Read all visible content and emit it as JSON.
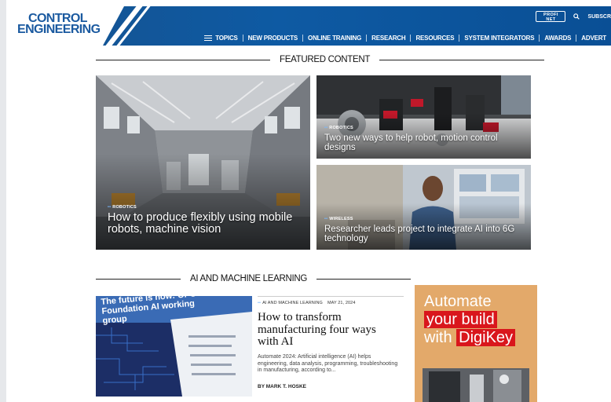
{
  "brand": {
    "logo_line1": "CONTROL",
    "logo_line2": "ENGINEERING",
    "profinet_line1": "PROFI",
    "profinet_line2": "NET"
  },
  "header": {
    "subscribe_label": "SUBSCR",
    "nav": [
      "TOPICS",
      "NEW PRODUCTS",
      "ONLINE TRAINING",
      "RESEARCH",
      "RESOURCES",
      "SYSTEM INTEGRATORS",
      "AWARDS",
      "ADVERT"
    ]
  },
  "featured": {
    "heading": "FEATURED CONTENT",
    "main": {
      "category": "ROBOTICS",
      "title": "How to produce flexibly using mobile robots, machine vision"
    },
    "side1": {
      "category": "ROBOTICS",
      "title": "Two new ways to help robot, motion control designs"
    },
    "side2": {
      "category": "WIRELESS",
      "title": "Researcher leads project to integrate AI into 6G technology"
    }
  },
  "ai_section": {
    "heading": "AI AND MACHINE LEARNING",
    "article": {
      "category": "AI AND MACHINE LEARNING",
      "date": "MAY 21, 2024",
      "title": "How to transform manufacturing four ways with AI",
      "excerpt": "Automate 2024: Artificial intelligence (AI) helps engineering, data analysis, programming, troubleshooting in manufacturing, according to...",
      "author": "BY MARK T. HOSKE",
      "image_heading": "The future is now: OPC Foundation AI working group"
    }
  },
  "ad": {
    "line1": "Automate",
    "line2": "your build",
    "line3_prefix": "with",
    "line3_brand": "DigiKey"
  },
  "colors": {
    "header_blue": "#0e5aa3",
    "link_dots": "#79b9ff",
    "ad_bg": "#e3a96a",
    "ad_red": "#d9161c"
  }
}
